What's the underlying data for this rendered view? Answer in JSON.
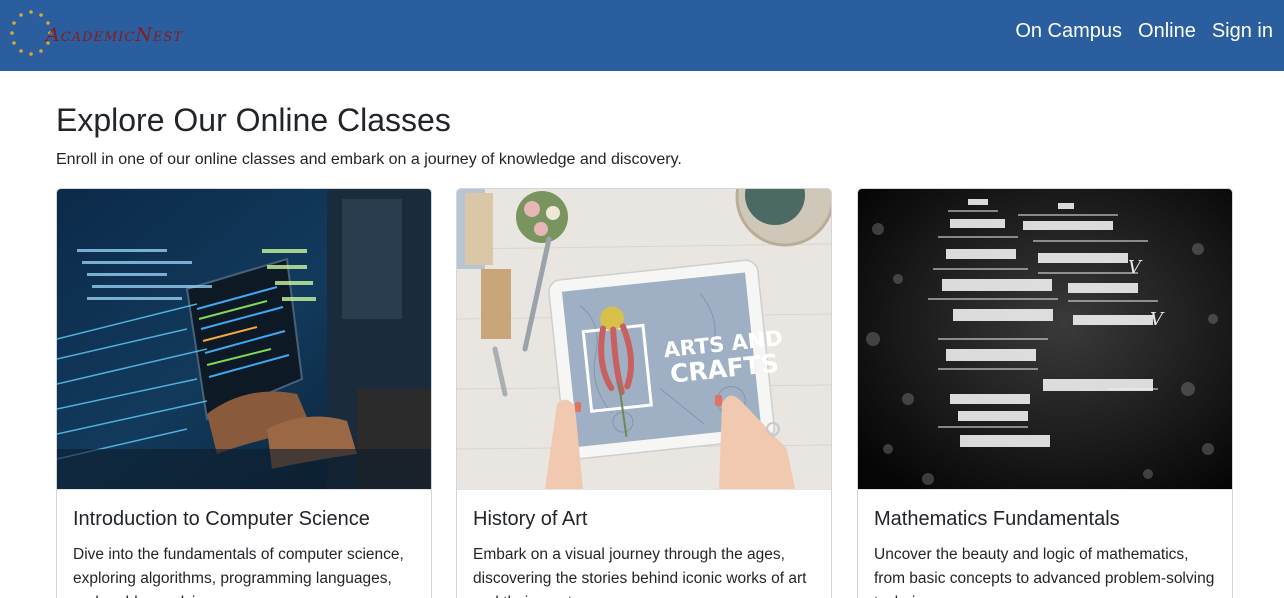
{
  "brand": {
    "name": "AcademicNest"
  },
  "nav": {
    "items": [
      {
        "label": "On Campus"
      },
      {
        "label": "Online"
      },
      {
        "label": "Sign in"
      }
    ]
  },
  "main": {
    "heading": "Explore Our Online Classes",
    "subtitle": "Enroll in one of our online classes and embark on a journey of knowledge and discovery."
  },
  "courses": [
    {
      "title": "Introduction to Computer Science",
      "description": "Dive into the fundamentals of computer science, exploring algorithms, programming languages, and problem-solving",
      "image_icon": "computer-code-photo"
    },
    {
      "title": "History of Art",
      "description": "Embark on a visual journey through the ages, discovering the stories behind iconic works of art and their creators",
      "image_icon": "arts-and-crafts-tablet-photo",
      "image_text": [
        "ARTS AND",
        "CRAFTS"
      ]
    },
    {
      "title": "Mathematics Fundamentals",
      "description": "Uncover the beauty and logic of mathematics, from basic concepts to advanced problem-solving techniques",
      "image_icon": "math-formulas-photo"
    }
  ],
  "colors": {
    "navbar": "#2a5e9e",
    "brand_text": "#8b1a1a",
    "brand_stars": "#d4a93a"
  }
}
